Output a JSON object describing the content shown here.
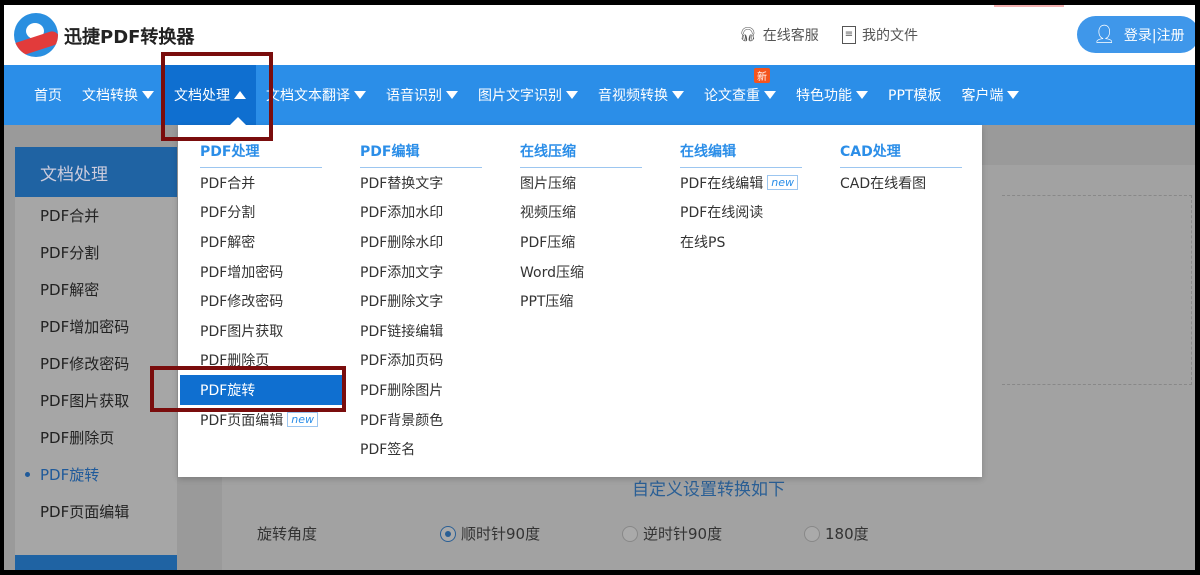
{
  "header": {
    "brand": "迅捷PDF转换器",
    "service": "在线客服",
    "files": "我的文件",
    "login": "登录|注册"
  },
  "nav": {
    "items": [
      "首页",
      "文档转换",
      "文档处理",
      "文档文本翻译",
      "语音识别",
      "图片文字识别",
      "音视频转换",
      "论文查重",
      "特色功能",
      "PPT模板",
      "客户端"
    ],
    "badge": "新"
  },
  "dropdown": {
    "columns": [
      {
        "title": "PDF处理",
        "items": [
          "PDF合并",
          "PDF分割",
          "PDF解密",
          "PDF增加密码",
          "PDF修改密码",
          "PDF图片获取",
          "PDF删除页",
          "PDF旋转",
          "PDF页面编辑"
        ]
      },
      {
        "title": "PDF编辑",
        "items": [
          "PDF替换文字",
          "PDF添加水印",
          "PDF删除水印",
          "PDF添加文字",
          "PDF删除文字",
          "PDF链接编辑",
          "PDF添加页码",
          "PDF删除图片",
          "PDF背景颜色",
          "PDF签名"
        ]
      },
      {
        "title": "在线压缩",
        "items": [
          "图片压缩",
          "视频压缩",
          "PDF压缩",
          "Word压缩",
          "PPT压缩"
        ]
      },
      {
        "title": "在线编辑",
        "items": [
          "PDF在线编辑",
          "PDF在线阅读",
          "在线PS"
        ]
      },
      {
        "title": "CAD处理",
        "items": [
          "CAD在线看图"
        ]
      }
    ],
    "new_tag": "new"
  },
  "sidebar": {
    "title": "文档处理",
    "items": [
      "PDF合并",
      "PDF分割",
      "PDF解密",
      "PDF增加密码",
      "PDF修改密码",
      "PDF图片获取",
      "PDF删除页",
      "PDF旋转",
      "PDF页面编辑"
    ]
  },
  "content": {
    "title": "自定义设置转换如下",
    "rotate_label": "旋转角度",
    "options": [
      "顺时针90度",
      "逆时针90度",
      "180度"
    ],
    "selected": "顺时针90度"
  },
  "colors": {
    "nav": "#2b8ee8",
    "active": "#0f6fd0",
    "highlight": "#7a0d0d"
  }
}
